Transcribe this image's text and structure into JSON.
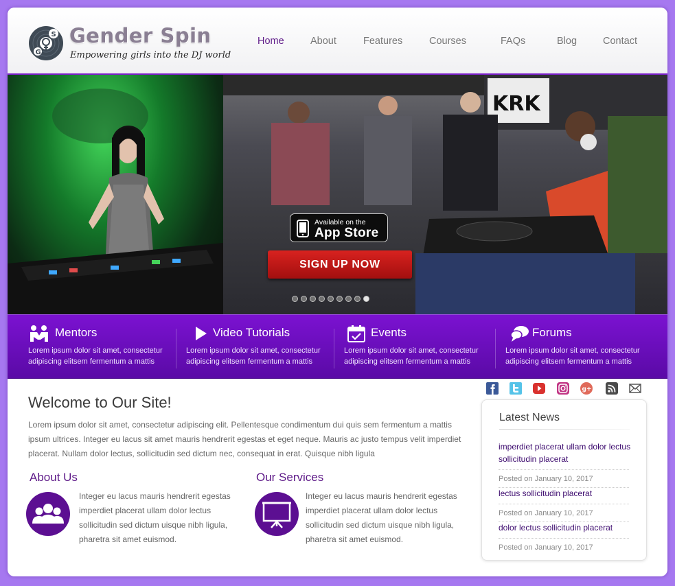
{
  "brand": {
    "name": "Gender Spin",
    "tagline": "Empowering girls into the DJ world",
    "logo_icon": "vinyl-gender-symbol-icon"
  },
  "nav": {
    "items": [
      {
        "label": "Home",
        "active": true
      },
      {
        "label": "About",
        "active": false
      },
      {
        "label": "Features",
        "active": false
      },
      {
        "label": "Courses",
        "active": false
      },
      {
        "label": "FAQs",
        "active": false
      },
      {
        "label": "Blog",
        "active": false
      },
      {
        "label": "Contact",
        "active": false
      }
    ]
  },
  "hero": {
    "appstore": {
      "small": "Available on the",
      "big": "App Store",
      "icon": "phone-icon"
    },
    "signup_label": "SIGN UP NOW",
    "slide_count": 9,
    "active_slide": 9
  },
  "features": [
    {
      "title": "Mentors",
      "icon": "mentors-icon",
      "desc": "Lorem ipsum dolor sit amet, consectetur adipiscing elitsem fermentum a mattis"
    },
    {
      "title": "Video Tutorials",
      "icon": "play-icon",
      "desc": "Lorem ipsum dolor sit amet, consectetur adipiscing elitsem fermentum a mattis"
    },
    {
      "title": "Events",
      "icon": "calendar-icon",
      "desc": "Lorem ipsum dolor sit amet, consectetur adipiscing elitsem fermentum a mattis"
    },
    {
      "title": "Forums",
      "icon": "chat-bubble-icon",
      "desc": "Lorem ipsum dolor sit amet, consectetur adipiscing elitsem fermentum a mattis"
    }
  ],
  "welcome": {
    "title": "Welcome to Our Site!",
    "text": "Lorem ipsum dolor sit amet, consectetur adipiscing elit. Pellentesque condimentum dui quis sem fermentum a mattis ipsum ultrices. Integer eu lacus sit amet mauris hendrerit egestas et eget neque. Mauris ac justo tempus velit imperdiet placerat. Nullam dolor lectus, sollicitudin sed dictum nec, consequat in erat. Quisque nibh ligula"
  },
  "about": {
    "title": "About Us",
    "icon": "group-icon",
    "text": "Integer eu lacus mauris hendrerit egestas imperdiet placerat ullam dolor lectus sollicitudin sed dictum uisque nibh ligula, pharetra sit amet euismod."
  },
  "services": {
    "title": "Our Services",
    "icon": "presentation-icon",
    "text": "Integer eu lacus mauris hendrerit egestas imperdiet placerat ullam dolor lectus sollicitudin sed dictum uisque nibh ligula, pharetra sit amet euismod."
  },
  "social": [
    {
      "name": "facebook-icon",
      "color": "#3b5998"
    },
    {
      "name": "twitter-icon",
      "color": "#55c3e8"
    },
    {
      "name": "youtube-icon",
      "color": "#d9312e"
    },
    {
      "name": "instagram-icon",
      "color": "#c13584"
    },
    {
      "name": "google-plus-icon",
      "color": "#e06a5a"
    },
    {
      "name": "rss-icon",
      "color": "#4a4a4a"
    },
    {
      "name": "email-icon",
      "color": "#555555"
    }
  ],
  "news": {
    "title": "Latest News",
    "items": [
      {
        "title": "imperdiet placerat ullam dolor lectus sollicitudin placerat",
        "date": "Posted on January 10, 2017"
      },
      {
        "title": "lectus sollicitudin placerat",
        "date": "Posted on January 10, 2017"
      },
      {
        "title": "dolor lectus sollicitudin placerat",
        "date": "Posted on January 10, 2017"
      }
    ]
  },
  "colors": {
    "page_bg": "#a678f0",
    "accent_purple": "#6a0fbd",
    "heading_purple": "#5e1a88",
    "signup_red": "#c41a17"
  }
}
